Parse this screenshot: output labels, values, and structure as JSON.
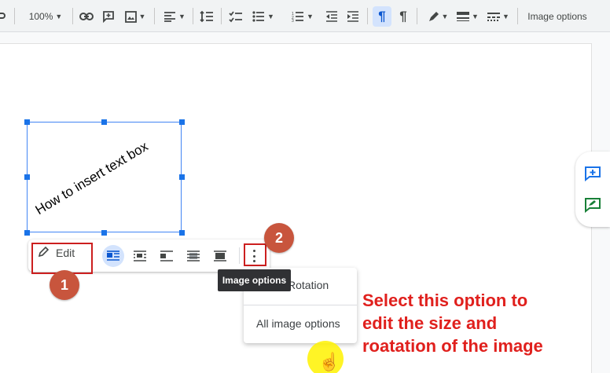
{
  "toolbar": {
    "zoom": "100%",
    "image_options_label": "Image options",
    "icons": [
      "undo-icon",
      "link-icon",
      "add-comment-icon",
      "insert-image-icon",
      "align-icon",
      "line-spacing-icon",
      "checklist-icon",
      "bullet-list-icon",
      "numbered-list-icon",
      "decrease-indent-icon",
      "increase-indent-icon",
      "ltr-paragraph-icon",
      "rtl-paragraph-icon",
      "border-color-icon",
      "border-weight-icon",
      "border-dash-icon"
    ]
  },
  "document": {
    "image_text": "How to insert text box"
  },
  "image_toolbar": {
    "edit_label": "Edit",
    "wrap_modes": [
      "inline",
      "wrap-text",
      "break-text",
      "behind-text",
      "in-front-of-text"
    ],
    "active_wrap": "inline"
  },
  "tooltip": "Image options",
  "menu": {
    "items": [
      "Rotation",
      "All image options"
    ]
  },
  "annotations": {
    "badge1": "1",
    "badge2": "2",
    "callout_line1": "Select this option to",
    "callout_line2": "edit the size and",
    "callout_line3": "roatation of the image",
    "colors": {
      "callout": "#e0201d",
      "box": "#cc1f1f",
      "badge": "#c8553d",
      "cursor_highlight": "#fff200"
    }
  },
  "side_panel": {
    "icons": [
      "add-comment-icon",
      "suggest-edit-icon"
    ]
  }
}
